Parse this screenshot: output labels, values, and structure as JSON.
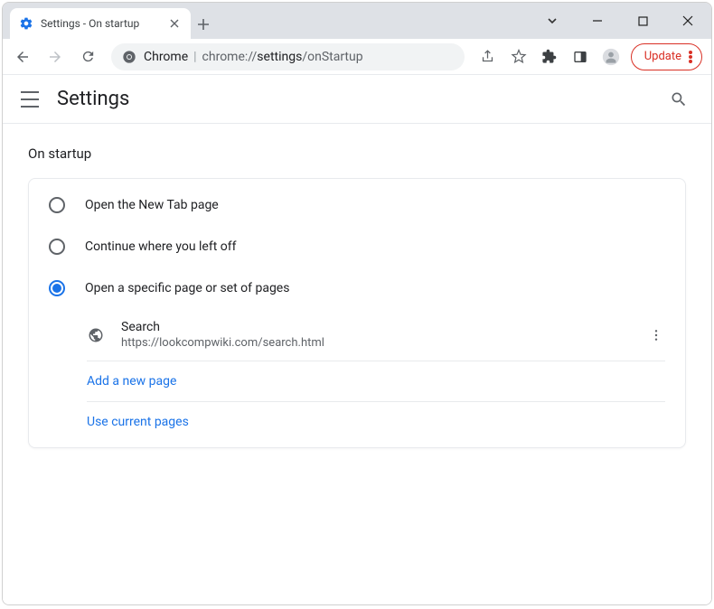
{
  "tab": {
    "title": "Settings - On startup"
  },
  "address": {
    "host": "Chrome",
    "prefix": "chrome://",
    "path_mid": "settings",
    "path_tail": "/onStartup"
  },
  "update_label": "Update",
  "settings": {
    "title": "Settings",
    "section_title": "On startup",
    "options": [
      {
        "label": "Open the New Tab page",
        "selected": false
      },
      {
        "label": "Continue where you left off",
        "selected": false
      },
      {
        "label": "Open a specific page or set of pages",
        "selected": true
      }
    ],
    "pages": [
      {
        "name": "Search",
        "url": "https://lookcompwiki.com/search.html"
      }
    ],
    "add_page_label": "Add a new page",
    "use_current_label": "Use current pages"
  }
}
